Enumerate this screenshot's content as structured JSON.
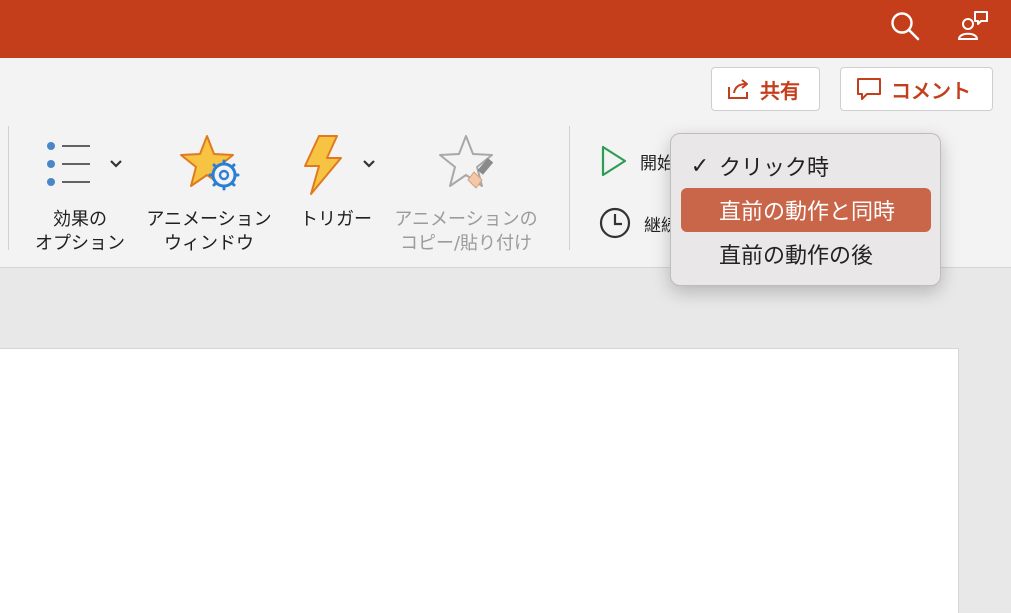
{
  "titlebar": {
    "bg_color": "#c43e1c",
    "icons": [
      "search-icon",
      "people-chat-icon"
    ]
  },
  "header_buttons": {
    "share": {
      "label": "共有",
      "icon": "share-icon"
    },
    "comment": {
      "label": "コメント",
      "icon": "comment-icon"
    }
  },
  "ribbon": {
    "effect_options": {
      "line1": "効果の",
      "line2": "オプション"
    },
    "animation_pane": {
      "line1": "アニメーション",
      "line2": "ウィンドウ"
    },
    "trigger": {
      "line1": "トリガー"
    },
    "animation_painter": {
      "line1": "アニメーションの",
      "line2": "コピー/貼り付け"
    },
    "start": {
      "label": "開始"
    },
    "duration": {
      "label": "継続"
    }
  },
  "start_dropdown": {
    "items": [
      {
        "label": "クリック時",
        "checked": true,
        "selected": false
      },
      {
        "label": "直前の動作と同時",
        "checked": false,
        "selected": true
      },
      {
        "label": "直前の動作の後",
        "checked": false,
        "selected": false
      }
    ],
    "checkmark": "✓",
    "highlight_color": "#c9664a"
  }
}
